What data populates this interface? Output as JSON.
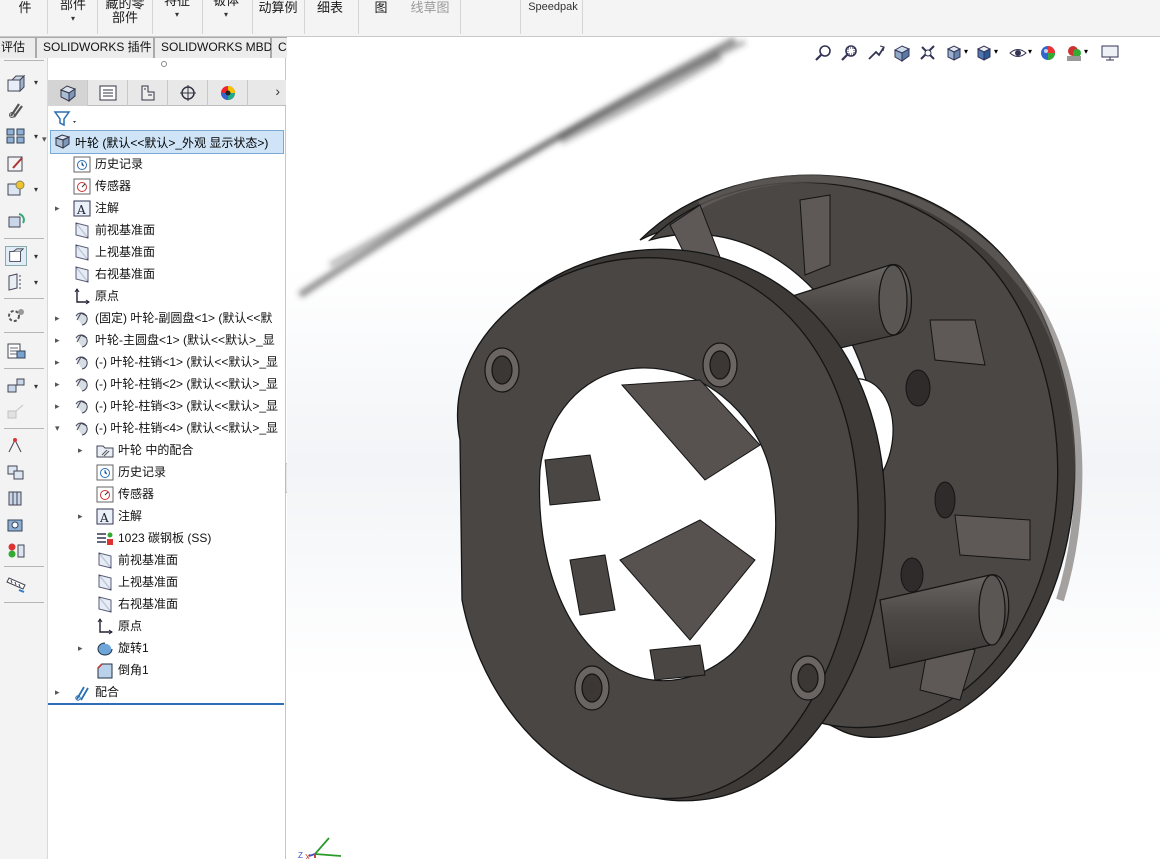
{
  "ribbon": {
    "items": [
      "件",
      "部件",
      "藏的零\n部件",
      "特征",
      "钣体",
      "动算例",
      "细表",
      "图",
      "线草图",
      "Speedpak"
    ]
  },
  "tabs": [
    "评估",
    "SOLIDWORKS 插件",
    "SOLIDWORKS MBD",
    "CircuitWorks"
  ],
  "feature_manager": {
    "root": "叶轮  (默认<<默认>_外观 显示状态>)",
    "rows": [
      {
        "label": "历史记录",
        "icon": "history-icon"
      },
      {
        "label": "传感器",
        "icon": "sensor-icon"
      },
      {
        "label": "注解",
        "icon": "annotation-icon"
      },
      {
        "label": "前视基准面",
        "icon": "plane-icon"
      },
      {
        "label": "上视基准面",
        "icon": "plane-icon"
      },
      {
        "label": "右视基准面",
        "icon": "plane-icon"
      },
      {
        "label": "原点",
        "icon": "origin-icon"
      },
      {
        "label": "(固定) 叶轮-副圆盘<1> (默认<<默",
        "icon": "part-icon"
      },
      {
        "label": "叶轮-主圆盘<1> (默认<<默认>_显",
        "icon": "part-icon"
      },
      {
        "label": "(-) 叶轮-柱销<1> (默认<<默认>_显",
        "icon": "part-icon"
      },
      {
        "label": "(-) 叶轮-柱销<2> (默认<<默认>_显",
        "icon": "part-icon"
      },
      {
        "label": "(-) 叶轮-柱销<3> (默认<<默认>_显",
        "icon": "part-icon"
      },
      {
        "label": "(-) 叶轮-柱销<4> (默认<<默认>_显",
        "icon": "part-icon"
      },
      {
        "label": "叶轮 中的配合",
        "icon": "mates-folder-icon"
      },
      {
        "label": "历史记录",
        "icon": "history-icon"
      },
      {
        "label": "传感器",
        "icon": "sensor-icon"
      },
      {
        "label": "注解",
        "icon": "annotation-icon"
      },
      {
        "label": "1023 碳钢板 (SS)",
        "icon": "material-icon"
      },
      {
        "label": "前视基准面",
        "icon": "plane-icon"
      },
      {
        "label": "上视基准面",
        "icon": "plane-icon"
      },
      {
        "label": "右视基准面",
        "icon": "plane-icon"
      },
      {
        "label": "原点",
        "icon": "origin-icon"
      },
      {
        "label": "旋转1",
        "icon": "revolve-icon"
      },
      {
        "label": "倒角1",
        "icon": "chamfer-icon"
      },
      {
        "label": "配合",
        "icon": "mates-icon"
      }
    ]
  },
  "triad": {
    "z": "Z",
    "x": "X"
  },
  "colors": {
    "selection": "#cfe4f7",
    "accent": "#2f6fb5",
    "model": "#4a4644"
  }
}
